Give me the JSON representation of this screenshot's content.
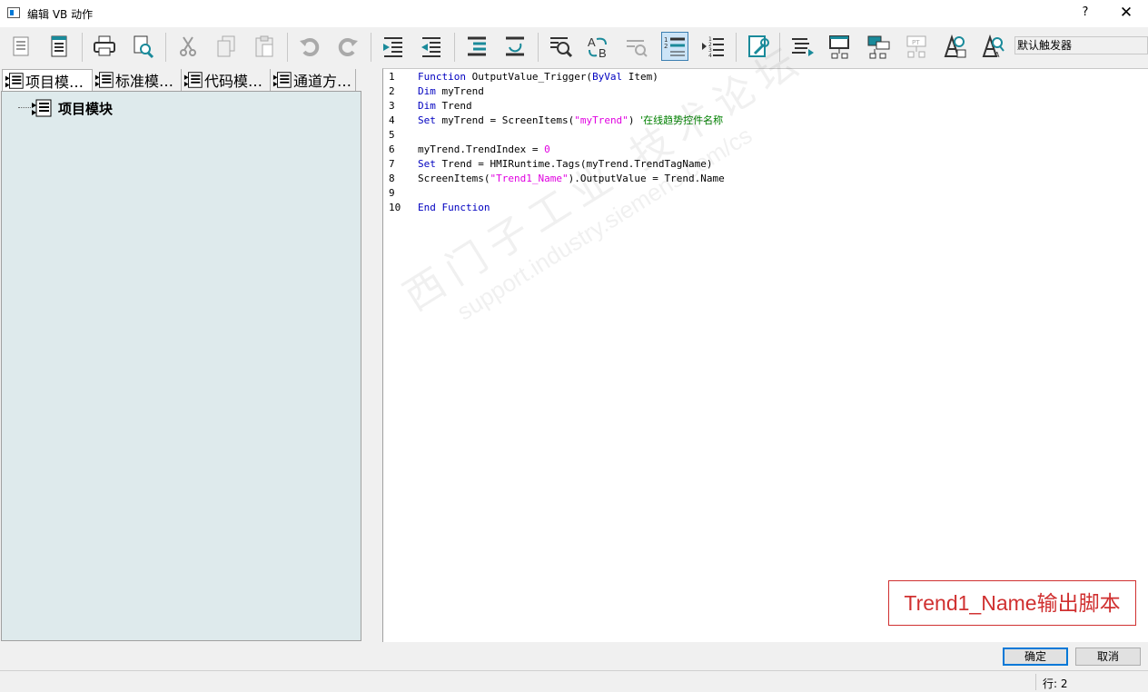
{
  "window": {
    "title": "编辑 VB 动作",
    "help_label": "?",
    "close_label": "✕"
  },
  "toolbar": {
    "trigger_dropdown_value": "默认触发器",
    "buttons": [
      {
        "icon": "properties-icon"
      },
      {
        "icon": "info-icon"
      },
      {
        "icon": "print-icon"
      },
      {
        "icon": "print-preview-icon"
      },
      {
        "icon": "cut-icon"
      },
      {
        "icon": "copy-icon"
      },
      {
        "icon": "paste-icon"
      },
      {
        "icon": "undo-icon"
      },
      {
        "icon": "redo-icon"
      },
      {
        "icon": "indent-icon"
      },
      {
        "icon": "outdent-icon"
      },
      {
        "icon": "comment-icon"
      },
      {
        "icon": "uncomment-icon"
      },
      {
        "icon": "find-icon"
      },
      {
        "icon": "replace-icon"
      },
      {
        "icon": "goto-icon"
      },
      {
        "icon": "line-numbers-icon",
        "active": true
      },
      {
        "icon": "bookmarks-icon"
      },
      {
        "icon": "compile-icon"
      },
      {
        "icon": "format-icon"
      },
      {
        "icon": "tag-selection-icon"
      },
      {
        "icon": "object-browser-icon"
      },
      {
        "icon": "pt-icon"
      },
      {
        "icon": "syntax-check-icon"
      },
      {
        "icon": "intellisense-icon"
      }
    ]
  },
  "tabs": [
    {
      "label": "项目模…",
      "active": true
    },
    {
      "label": "标准模…"
    },
    {
      "label": "代码模…"
    },
    {
      "label": "通道方…"
    }
  ],
  "tree": {
    "root_label": "项目模块"
  },
  "editor": {
    "lines": [
      {
        "no": "1",
        "segments": [
          {
            "t": "Function",
            "c": "kw"
          },
          {
            "t": " OutputValue_Trigger(",
            "c": ""
          },
          {
            "t": "ByVal",
            "c": "kw"
          },
          {
            "t": " Item)",
            "c": ""
          }
        ]
      },
      {
        "no": "2",
        "segments": [
          {
            "t": "Dim",
            "c": "kw"
          },
          {
            "t": " myTrend",
            "c": ""
          }
        ]
      },
      {
        "no": "3",
        "segments": [
          {
            "t": "Dim",
            "c": "kw"
          },
          {
            "t": " Trend",
            "c": ""
          }
        ]
      },
      {
        "no": "4",
        "segments": [
          {
            "t": "Set",
            "c": "kw"
          },
          {
            "t": " myTrend = ScreenItems(",
            "c": ""
          },
          {
            "t": "\"myTrend\"",
            "c": "str"
          },
          {
            "t": ") ",
            "c": ""
          },
          {
            "t": "'在线趋势控件名称",
            "c": "cmt"
          }
        ]
      },
      {
        "no": "5",
        "segments": []
      },
      {
        "no": "6",
        "segments": [
          {
            "t": "myTrend.TrendIndex = ",
            "c": ""
          },
          {
            "t": "0",
            "c": "num"
          }
        ]
      },
      {
        "no": "7",
        "segments": [
          {
            "t": "Set",
            "c": "kw"
          },
          {
            "t": " Trend = HMIRuntime.Tags(myTrend.TrendTagName)",
            "c": ""
          }
        ]
      },
      {
        "no": "8",
        "segments": [
          {
            "t": "ScreenItems(",
            "c": ""
          },
          {
            "t": "\"Trend1_Name\"",
            "c": "str"
          },
          {
            "t": ").OutputValue = Trend.Name",
            "c": ""
          }
        ]
      },
      {
        "no": "9",
        "segments": []
      },
      {
        "no": "10",
        "segments": [
          {
            "t": "End Function",
            "c": "kw"
          }
        ]
      }
    ]
  },
  "annotation": {
    "text": "Trend1_Name输出脚本",
    "color": "#d03030"
  },
  "watermark": {
    "line1": "西门子工业 技术论坛",
    "line2": "support.industry.siemens.com/cs"
  },
  "buttons": {
    "ok": "确定",
    "cancel": "取消"
  },
  "status": {
    "row": "行:  2"
  }
}
